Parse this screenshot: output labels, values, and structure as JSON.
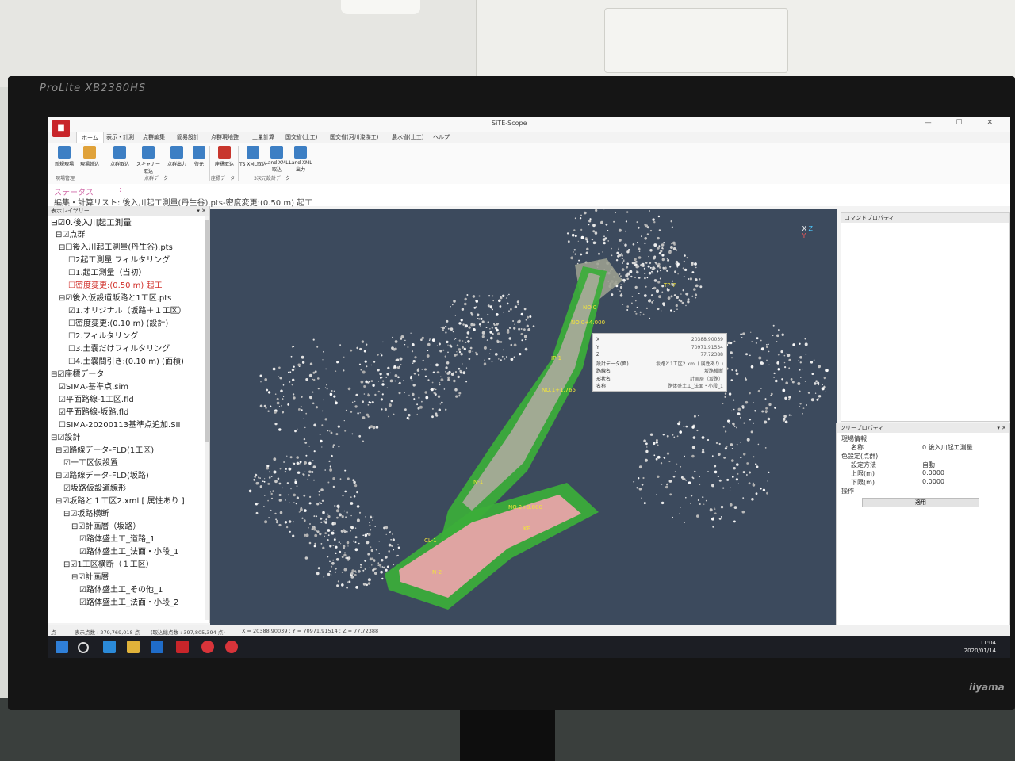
{
  "monitor": {
    "brand_top": "ProLite XB2380HS",
    "brand_bottom": "iiyama"
  },
  "app": {
    "title": "SiTE-Scope",
    "tabs": [
      "ホーム",
      "表示・計測",
      "点群編集",
      "簡易設計",
      "点群現地整",
      "土量計算",
      "国交省(土工)",
      "国交省(河川浚渫工)",
      "農水省(土工)",
      "ヘルプ"
    ],
    "ribbon": {
      "buttons": [
        "新規現場",
        "現場読込",
        "点群取込",
        "スキャナー取込",
        "点群出力",
        "復元",
        "座標取込",
        "TS XML取込",
        "Land XML取込",
        "Land XML出力"
      ],
      "groups": [
        "現場管理",
        "点群データ",
        "座標データ",
        "3次元設計データ"
      ]
    },
    "status": {
      "label": "ステータス",
      "separator": ":",
      "line": "編集・計算リスト: 後入川起工測量(丹生谷).pts-密度変更:(0.50 m) 起工"
    }
  },
  "layer_panel": {
    "title": "表示レイヤリー",
    "items": [
      {
        "text": "⊟☑0.後入川起工測量",
        "red": false
      },
      {
        "text": "⊟☑点群",
        "red": false
      },
      {
        "text": "⊟☐後入川起工測量(丹生谷).pts",
        "red": false
      },
      {
        "text": "☐2起工測量 フィルタリング",
        "red": false
      },
      {
        "text": "☐1.起工測量（当初）",
        "red": false
      },
      {
        "text": "☐密度変更:(0.50 m) 起工",
        "red": true
      },
      {
        "text": "⊟☑後入仮設道販路と1工区.pts",
        "red": false
      },
      {
        "text": "☑1.オリジナル（坂路＋１工区）",
        "red": false
      },
      {
        "text": "☐密度変更:(0.10 m) (設計)",
        "red": false
      },
      {
        "text": "☐2.フィルタリング",
        "red": false
      },
      {
        "text": "☐3.土嚢だけフィルタリング",
        "red": false
      },
      {
        "text": "☐4.土嚢間引き:(0.10 m) (面積)",
        "red": false
      },
      {
        "text": "⊟☑座標データ",
        "red": false
      },
      {
        "text": "☑SIMA-基準点.sim",
        "red": false
      },
      {
        "text": "☑平面路線-1工区.fld",
        "red": false
      },
      {
        "text": "☑平面路線-坂路.fld",
        "red": false
      },
      {
        "text": "☐SIMA-20200113基準点追加.SII",
        "red": false
      },
      {
        "text": "⊟☑設計",
        "red": false
      },
      {
        "text": "⊟☑路線データ-FLD(1工区)",
        "red": false
      },
      {
        "text": "☑一工区仮設置",
        "red": false
      },
      {
        "text": "⊟☑路線データ-FLD(坂路)",
        "red": false
      },
      {
        "text": "☑坂路仮設道線形",
        "red": false
      },
      {
        "text": "⊟☑坂路と１工区2.xml [ 属性あり ]",
        "red": false
      },
      {
        "text": "⊟☑坂路横断",
        "red": false
      },
      {
        "text": "⊟☑計画層（坂路）",
        "red": false
      },
      {
        "text": "☑路体盛土工_道路_1",
        "red": false
      },
      {
        "text": "☑路体盛土工_法面・小段_1",
        "red": false
      },
      {
        "text": "⊟☑1工区横断（１工区）",
        "red": false
      },
      {
        "text": "⊟☑計画層",
        "red": false
      },
      {
        "text": "☑路体盛土工_その他_1",
        "red": false
      },
      {
        "text": "☑路体盛土工_法面・小段_2",
        "red": false
      }
    ]
  },
  "viewport": {
    "axis_x": "X",
    "axis_y": "Y",
    "axis_z": "Z",
    "labels": [
      "NO.0",
      "NO.0+4.000",
      "BC",
      "NO.1+1.765",
      "NO.2+0.000",
      "IP-1",
      "TP-7",
      "N-1",
      "KE",
      "CL-1",
      "N-2"
    ]
  },
  "popup": {
    "rows": [
      {
        "key": "X",
        "value": "20388.90039"
      },
      {
        "key": "Y",
        "value": "70971.91534"
      },
      {
        "key": "Z",
        "value": "77.72388"
      },
      {
        "key": "設計データ(面)",
        "value": "坂路と1工区2.xml ( 属性あり )"
      },
      {
        "key": "路線名",
        "value": "坂路横断"
      },
      {
        "key": "形状名",
        "value": "計画層（坂路）"
      },
      {
        "key": "名称",
        "value": "路体盛土工_法面・小段_1"
      }
    ]
  },
  "command_panel": {
    "title": "コマンドプロパティ"
  },
  "tree_props": {
    "title": "ツリープロパティ",
    "site_info": "現場情報",
    "name_label": "名称",
    "name_value": "0.後入川起工測量",
    "color_section": "色設定(点群)",
    "method_label": "設定方法",
    "method_value": "自動",
    "upper_label": "上限(m)",
    "upper_value": "0.0000",
    "lower_label": "下限(m)",
    "lower_value": "0.0000",
    "ops_label": "操作",
    "apply_label": "適用"
  },
  "statusbar": {
    "mode": "点",
    "display": "表示点数 : 279,769,018 点",
    "total": "(取込総点数 : 397,805,394 点)",
    "coords": "X = 20388.90039 ; Y = 70971.91514 ; Z = 77.72388"
  },
  "taskbar": {
    "time": "11:04",
    "date": "2020/01/14"
  },
  "colors": {
    "accent": "#c8252a",
    "point_bg": "#3c4a5d",
    "design_green": "#3cae3a",
    "design_pink": "#e8a3a8"
  }
}
